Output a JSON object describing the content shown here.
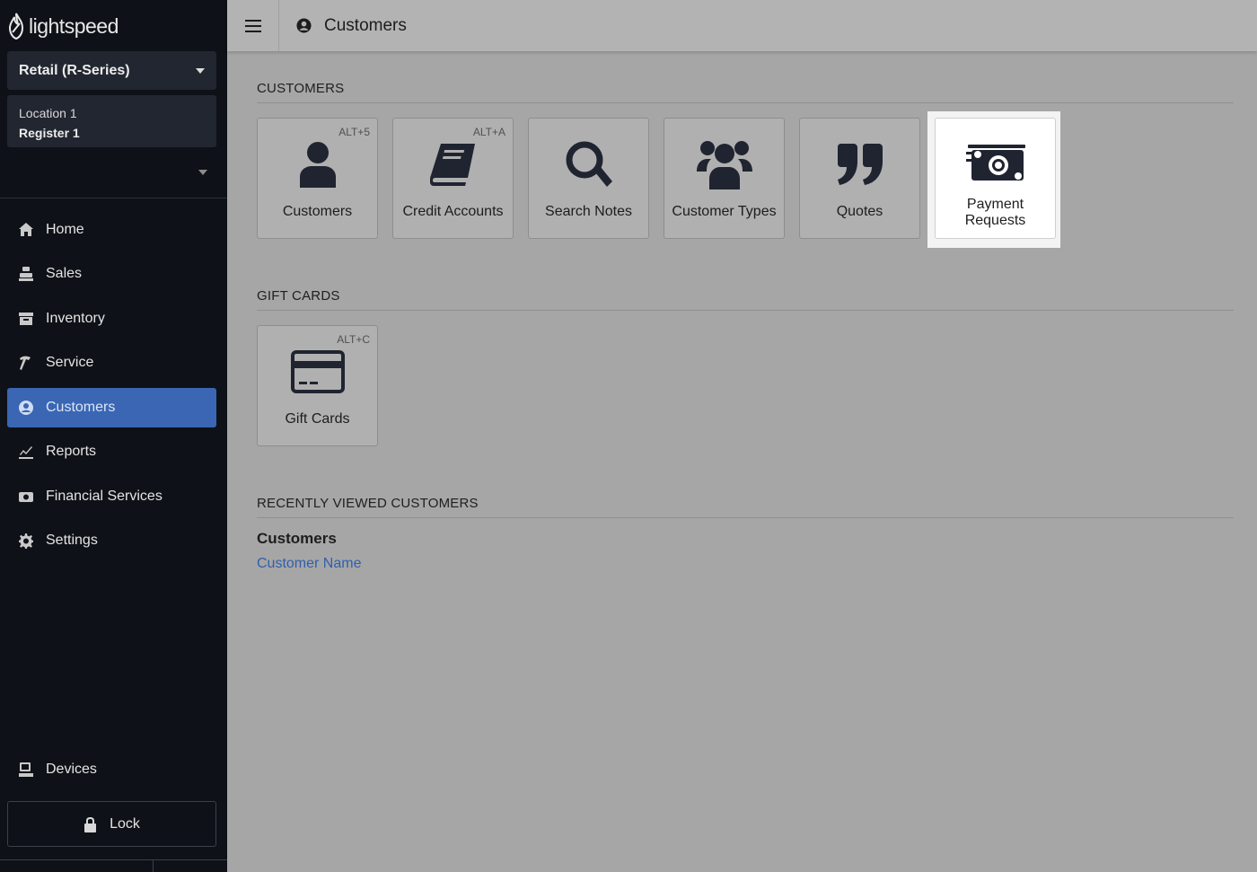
{
  "sidebar": {
    "logo_text": "lightspeed",
    "store_select": "Retail (R-Series)",
    "location": "Location 1",
    "register": "Register 1",
    "nav": [
      {
        "label": "Home",
        "icon": "home-icon"
      },
      {
        "label": "Sales",
        "icon": "sales-icon"
      },
      {
        "label": "Inventory",
        "icon": "inventory-icon"
      },
      {
        "label": "Service",
        "icon": "service-icon"
      },
      {
        "label": "Customers",
        "icon": "customers-icon",
        "active": true
      },
      {
        "label": "Reports",
        "icon": "reports-icon"
      },
      {
        "label": "Financial Services",
        "icon": "financial-services-icon"
      },
      {
        "label": "Settings",
        "icon": "settings-icon"
      }
    ],
    "devices_label": "Devices",
    "lock_label": "Lock"
  },
  "topbar": {
    "title": "Customers"
  },
  "sections": {
    "customers": {
      "title": "CUSTOMERS",
      "tiles": [
        {
          "label": "Customers",
          "shortcut": "ALT+5",
          "icon": "person-icon"
        },
        {
          "label": "Credit Accounts",
          "shortcut": "ALT+A",
          "icon": "book-icon"
        },
        {
          "label": "Search Notes",
          "shortcut": "",
          "icon": "search-icon"
        },
        {
          "label": "Customer Types",
          "shortcut": "",
          "icon": "users-icon"
        },
        {
          "label": "Quotes",
          "shortcut": "",
          "icon": "quote-icon"
        },
        {
          "label": "Payment Requests",
          "shortcut": "",
          "icon": "money-icon"
        }
      ]
    },
    "gift_cards": {
      "title": "GIFT CARDS",
      "tiles": [
        {
          "label": "Gift Cards",
          "shortcut": "ALT+C",
          "icon": "credit-card-icon"
        }
      ]
    },
    "recent": {
      "title": "RECENTLY VIEWED CUSTOMERS",
      "heading": "Customers",
      "link": "Customer Name"
    }
  },
  "colors": {
    "sidebar_bg": "#0e1117",
    "active_nav": "#3a66b3",
    "content_bg": "#a6a6a6",
    "link": "#2f5fae"
  }
}
